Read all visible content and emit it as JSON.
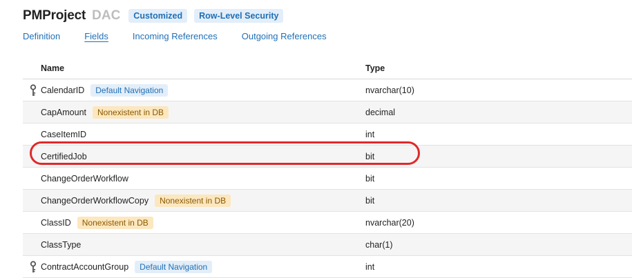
{
  "header": {
    "title": "PMProject",
    "subtitle": "DAC",
    "badges": [
      "Customized",
      "Row-Level Security"
    ]
  },
  "tabs": [
    {
      "label": "Definition",
      "active": false
    },
    {
      "label": "Fields",
      "active": true
    },
    {
      "label": "Incoming References",
      "active": false
    },
    {
      "label": "Outgoing References",
      "active": false
    }
  ],
  "table": {
    "headers": {
      "name": "Name",
      "type": "Type"
    },
    "rows": [
      {
        "name": "CalendarID",
        "tag": "Default Navigation",
        "type": "nvarchar(10)",
        "key": true
      },
      {
        "name": "CapAmount",
        "tag": "Nonexistent in DB",
        "type": "decimal",
        "key": false
      },
      {
        "name": "CaseItemID",
        "tag": "",
        "type": "int",
        "key": false
      },
      {
        "name": "CertifiedJob",
        "tag": "",
        "type": "bit",
        "key": false,
        "highlighted": true
      },
      {
        "name": "ChangeOrderWorkflow",
        "tag": "",
        "type": "bit",
        "key": false
      },
      {
        "name": "ChangeOrderWorkflowCopy",
        "tag": "Nonexistent in DB",
        "type": "bit",
        "key": false
      },
      {
        "name": "ClassID",
        "tag": "Nonexistent in DB",
        "type": "nvarchar(20)",
        "key": false
      },
      {
        "name": "ClassType",
        "tag": "",
        "type": "char(1)",
        "key": false
      },
      {
        "name": "ContractAccountGroup",
        "tag": "Default Navigation",
        "type": "int",
        "key": true
      }
    ]
  },
  "colors": {
    "accent": "#1f6fb5",
    "highlight": "#e0282a",
    "nonexistent_bg": "#fce7bf",
    "nav_bg": "#e3eef9"
  }
}
